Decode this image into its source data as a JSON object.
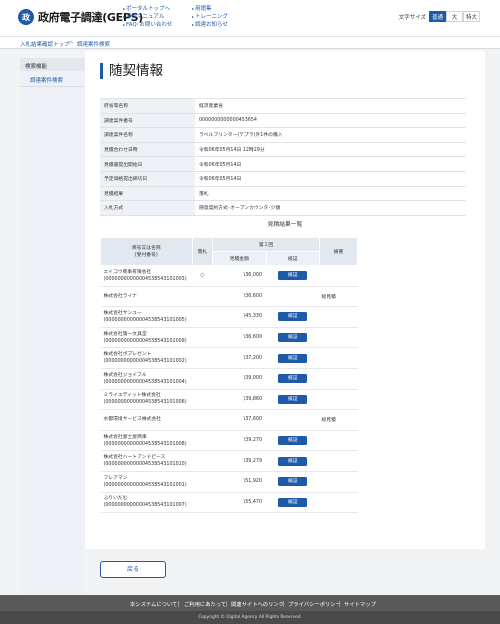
{
  "header": {
    "logo_mark": "政",
    "logo_text": "政府電子調達(GEPS)",
    "links_col1": [
      "ポータルトップへ",
      "操作マニュアル",
      "FAQ･お問い合わせ"
    ],
    "links_col2": [
      "用語集",
      "トレーニング",
      "調達お知らせ"
    ],
    "font_size_label": "文字サイズ",
    "font_sizes": [
      "普通",
      "大",
      "特大"
    ],
    "font_size_selected": "普通"
  },
  "breadcrumb": [
    "入札結果確認トップ",
    "調達案件検索"
  ],
  "breadcrumb_sep": ">",
  "sidebar": {
    "heading": "検索機能",
    "items": [
      "調達案件検索"
    ]
  },
  "page_title": "随契情報",
  "info": [
    {
      "label": "府省等名称",
      "value": "経済産業省"
    },
    {
      "label": "調達案件番号",
      "value": "0000000000000453654"
    },
    {
      "label": "調達案件名称",
      "value": "ラベルプリンター(テプラ)外1件の購入"
    },
    {
      "label": "見積合わせ日時",
      "value": "令和06年05月14日 12時29分"
    },
    {
      "label": "見積書提出開始日",
      "value": "令和06年05月14日"
    },
    {
      "label": "予定価格提出締切日",
      "value": "令和06年05月14日"
    },
    {
      "label": "見積結果",
      "value": "落札"
    },
    {
      "label": "入札方式",
      "value": "随意契約方式･オープンカウンタ･少額"
    }
  ],
  "results": {
    "title": "見積結果一覧",
    "col_name": "商号又は名称\n(受付番号)",
    "col_flag": "落札",
    "col_round": "第１回",
    "col_amount": "見積金額",
    "col_verify": "検証",
    "col_remarks": "摘要",
    "verify_label": "検証",
    "rows": [
      {
        "name": "エイコウ商事有限会社",
        "number": "(00000000000004538543101003)",
        "flag": "○",
        "amount": "\\36,000",
        "verify": true,
        "remark": ""
      },
      {
        "name": "株式会社ライナ",
        "number": "",
        "flag": "",
        "amount": "\\36,600",
        "verify": false,
        "remark": "総見積"
      },
      {
        "name": "株式会社サンユー",
        "number": "(00000000000004538543101005)",
        "flag": "",
        "amount": "\\45,330",
        "verify": true,
        "remark": ""
      },
      {
        "name": "株式会社第一文具堂",
        "number": "(00000000000004538543101009)",
        "flag": "",
        "amount": "\\36,600",
        "verify": true,
        "remark": ""
      },
      {
        "name": "株式会社ポプレゼント",
        "number": "(00000000000004538543101002)",
        "flag": "",
        "amount": "\\37,200",
        "verify": true,
        "remark": ""
      },
      {
        "name": "株式会社ジョイフル",
        "number": "(00000000000004538543101004)",
        "flag": "",
        "amount": "\\39,000",
        "verify": true,
        "remark": ""
      },
      {
        "name": "ミライエディット株式会社",
        "number": "(00000000000004538543101006)",
        "flag": "",
        "amount": "\\39,860",
        "verify": true,
        "remark": ""
      },
      {
        "name": "水都環境サービス株式会社",
        "number": "",
        "flag": "",
        "amount": "\\37,600",
        "verify": false,
        "remark": "総見積"
      },
      {
        "name": "株式会社富士屋商事",
        "number": "(00000000000004538543101008)",
        "flag": "",
        "amount": "\\39,270",
        "verify": true,
        "remark": ""
      },
      {
        "name": "株式会社ハートアンドピース",
        "number": "(00000000000004538543101010)",
        "flag": "",
        "amount": "\\39,279",
        "verify": true,
        "remark": ""
      },
      {
        "name": "フレアマン",
        "number": "(00000000000004538543101001)",
        "flag": "",
        "amount": "\\51,920",
        "verify": true,
        "remark": ""
      },
      {
        "name": "ふりいだむ",
        "number": "(00000000000004538543101007)",
        "flag": "",
        "amount": "\\55,470",
        "verify": true,
        "remark": ""
      }
    ]
  },
  "back_label": "戻る",
  "footer": {
    "links": [
      "本システムについて",
      "ご利用にあたって",
      "関連サイトへのリンク",
      "プライバシーポリシー",
      "サイトマップ"
    ],
    "copyright": "Copyright © Digital Agency All Rights Reserved."
  }
}
